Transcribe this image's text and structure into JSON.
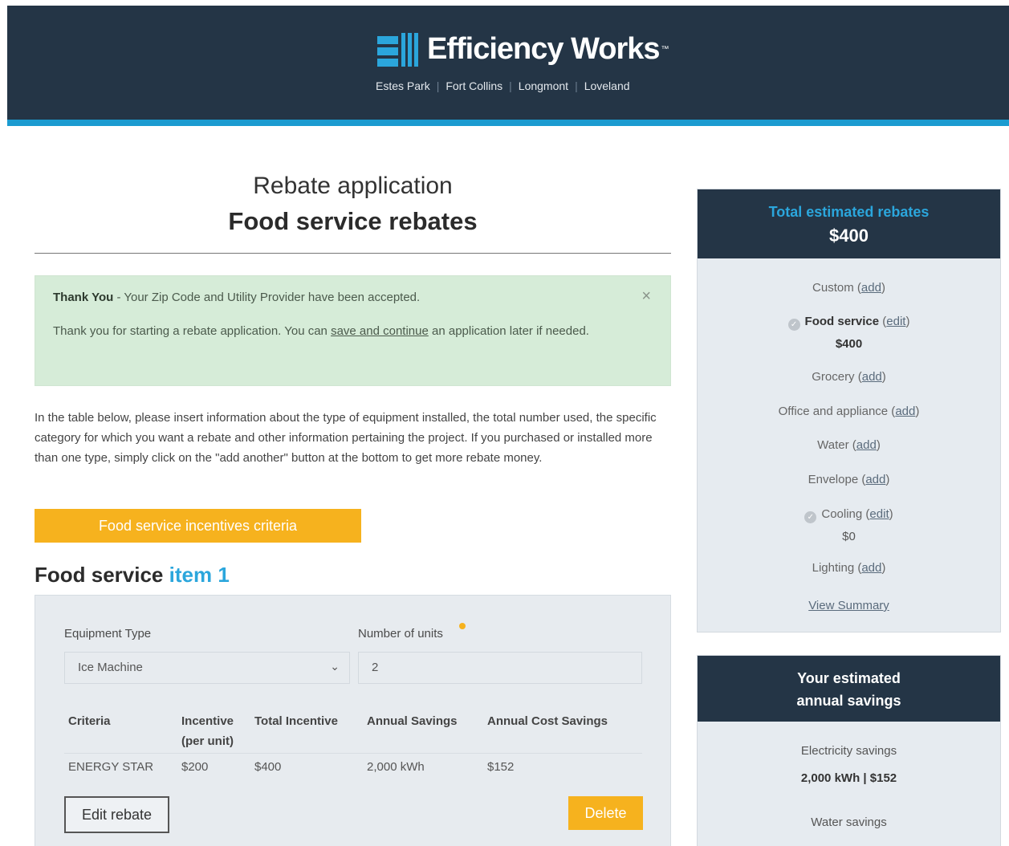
{
  "header": {
    "brand": "Efficiency Works",
    "trademark": "™",
    "cities": [
      "Estes Park",
      "Fort Collins",
      "Longmont",
      "Loveland"
    ],
    "colors": {
      "navy": "#243546",
      "accent_blue": "#1b9bd0"
    }
  },
  "page": {
    "title": "Rebate application",
    "subtitle": "Food service rebates"
  },
  "alert": {
    "strong": "Thank You",
    "message": " - Your Zip Code and Utility Provider have been accepted.",
    "line2_before": "Thank you for starting a rebate application. You can ",
    "link": "save and continue",
    "line2_after": " an application later if needed.",
    "close_icon": "×"
  },
  "intro": "In the table below, please insert information about the type of equipment installed, the total number used, the specific category for which you want a rebate and other information pertaining the project. If you purchased or installed more than one type, simply click on the \"add another\" button at the bottom to get more rebate money.",
  "criteria_button": "Food service incentives criteria",
  "item": {
    "heading_prefix": "Food service",
    "heading_accent": "item 1",
    "equipment_label": "Equipment Type",
    "equipment_value": "Ice Machine",
    "units_label": "Number of units",
    "units_value": "2",
    "table": {
      "headers": [
        "Criteria",
        "Incentive (per unit)",
        "Total Incentive",
        "Annual Savings",
        "Annual Cost Savings"
      ],
      "rows": [
        [
          "ENERGY STAR",
          "$200",
          "$400",
          "2,000 kWh",
          "$152"
        ]
      ]
    },
    "edit_button": "Edit rebate",
    "delete_button": "Delete"
  },
  "sidebar": {
    "total_title": "Total estimated rebates",
    "total_value": "$400",
    "categories": [
      {
        "name": "Custom",
        "action": "add"
      },
      {
        "name": "Food service",
        "action": "edit",
        "amount": "$400"
      },
      {
        "name": "Grocery",
        "action": "add"
      },
      {
        "name": "Office and appliance",
        "action": "add"
      },
      {
        "name": "Water",
        "action": "add"
      },
      {
        "name": "Envelope",
        "action": "add"
      },
      {
        "name": "Cooling",
        "action": "edit",
        "amount": "$0"
      },
      {
        "name": "Lighting",
        "action": "add"
      }
    ],
    "view_summary": "View Summary",
    "savings_title_1": "Your estimated",
    "savings_title_2": "annual savings",
    "electricity_label": "Electricity savings",
    "electricity_value": "2,000 kWh | $152",
    "water_label": "Water savings"
  }
}
